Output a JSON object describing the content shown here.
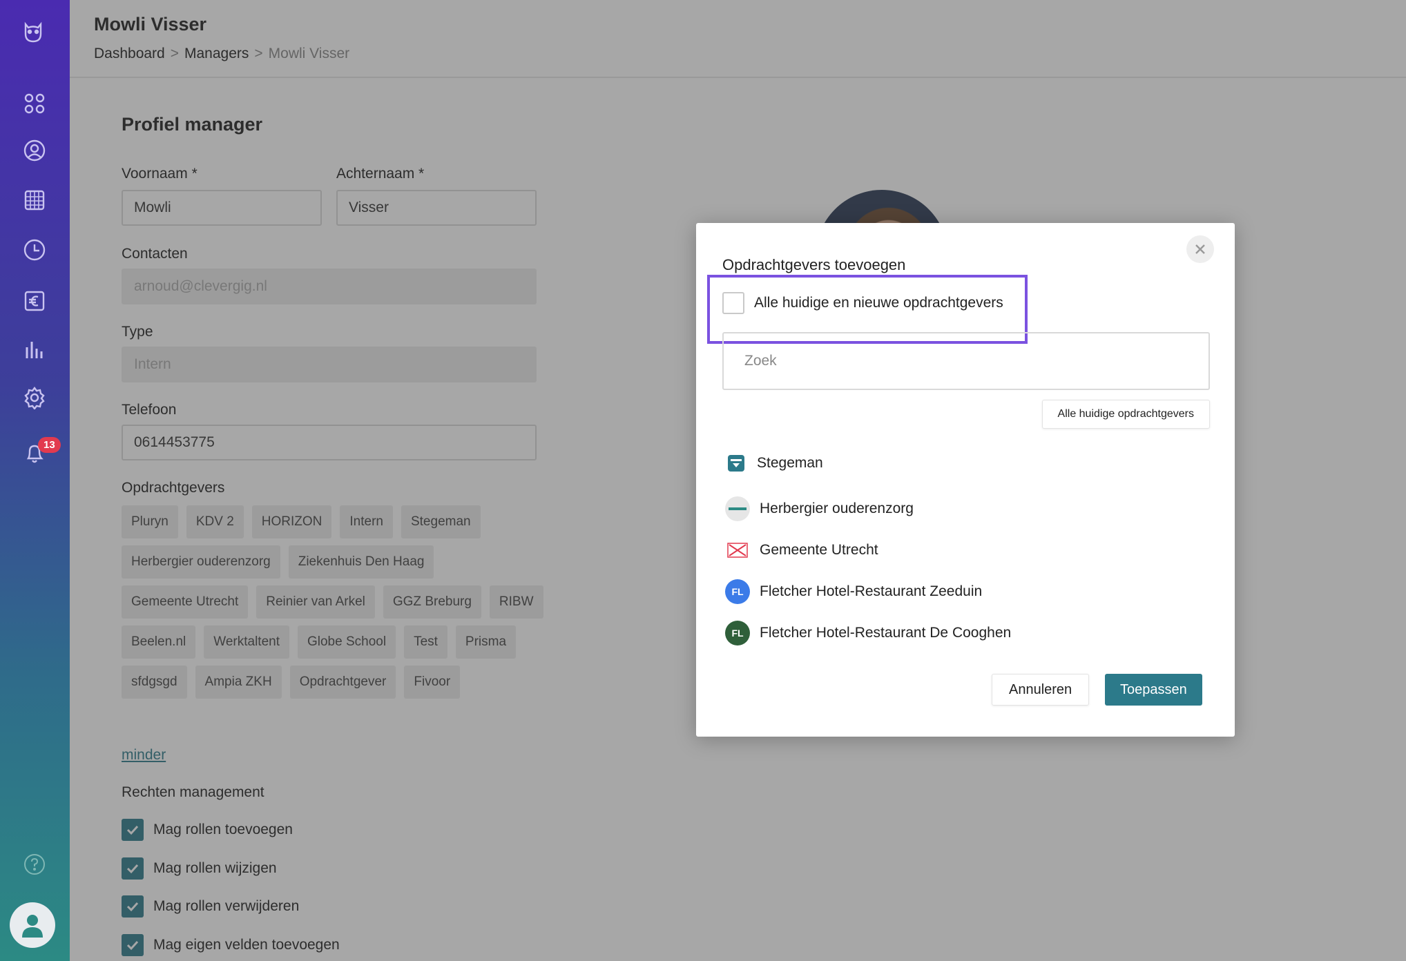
{
  "header": {
    "title": "Mowli Visser",
    "breadcrumb": {
      "dashboard": "Dashboard",
      "managers": "Managers",
      "current": "Mowli Visser",
      "separator": ">"
    }
  },
  "sidebar": {
    "icons": [
      "owl-logo-icon",
      "grid-icon",
      "user-circle-icon",
      "calendar-icon",
      "clock-icon",
      "euro-icon",
      "bar-chart-icon",
      "gear-icon",
      "bell-icon",
      "help-icon",
      "user-avatar-icon"
    ],
    "notification_count": "13"
  },
  "profile": {
    "section_title": "Profiel manager",
    "first_name_label": "Voornaam *",
    "first_name": "Mowli",
    "last_name_label": "Achternaam *",
    "last_name": "Visser",
    "contacts_label": "Contacten",
    "contacts": "arnoud@clevergig.nl",
    "type_label": "Type",
    "type": "Intern",
    "phone_label": "Telefoon",
    "phone": "0614453775",
    "clients_label": "Opdrachtgevers",
    "clients": [
      "Pluryn",
      "KDV 2",
      "HORIZON",
      "Intern",
      "Stegeman",
      "Herbergier ouderenzorg",
      "Ziekenhuis Den Haag",
      "Gemeente Utrecht",
      "Reinier van Arkel",
      "GGZ Breburg",
      "RIBW",
      "Beelen.nl",
      "Werktaltent",
      "Globe School",
      "Test",
      "Prisma",
      "sfdgsgd",
      "Ampia ZKH",
      "Opdrachtgever",
      "Fivoor"
    ],
    "less_link": "minder",
    "rights_label": "Rechten management",
    "rights": [
      "Mag rollen toevoegen",
      "Mag rollen wijzigen",
      "Mag rollen verwijderen",
      "Mag eigen velden toevoegen"
    ]
  },
  "modal": {
    "title": "Opdrachtgevers toevoegen",
    "all_checkbox_label": "Alle huidige en nieuwe opdrachtgevers",
    "search_placeholder": "Zoek",
    "all_current_button": "Alle huidige opdrachtgevers",
    "clients": [
      {
        "name": "Stegeman",
        "logo": "stegeman-logo",
        "initials": ""
      },
      {
        "name": "Herbergier ouderenzorg",
        "logo": "herbergier-logo",
        "initials": ""
      },
      {
        "name": "Gemeente Utrecht",
        "logo": "gemeente-utrecht-logo",
        "initials": ""
      },
      {
        "name": "Fletcher Hotel-Restaurant Zeeduin",
        "logo": "initials",
        "initials": "FL"
      },
      {
        "name": "Fletcher Hotel-Restaurant De Cooghen",
        "logo": "initials",
        "initials": "FL"
      }
    ],
    "cancel_label": "Annuleren",
    "apply_label": "Toepassen"
  },
  "colors": {
    "accent": "#2c7a8a",
    "highlight": "#7b52e0",
    "badge": "#e23a4f",
    "fl_blue": "#3b7be8",
    "fl_green": "#2f5f3a"
  }
}
